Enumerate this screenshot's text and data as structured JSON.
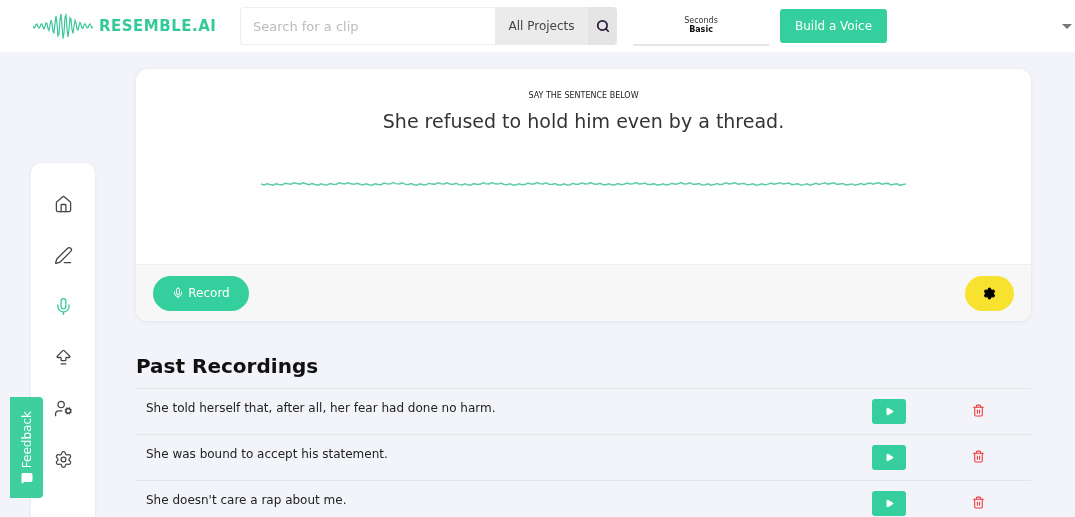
{
  "header": {
    "logo": "RESEMBLE.AI",
    "search": {
      "placeholder": "Search for a clip"
    },
    "project_filter": "All Projects",
    "plan": {
      "label": "Seconds",
      "value": "Basic"
    },
    "build_button": "Build a Voice"
  },
  "sidebar": {
    "items": [
      {
        "kind": "home",
        "selected": false
      },
      {
        "kind": "edit",
        "selected": false
      },
      {
        "kind": "record",
        "selected": true
      },
      {
        "kind": "upload",
        "selected": false
      },
      {
        "kind": "users",
        "selected": false
      },
      {
        "kind": "settings",
        "selected": false
      }
    ]
  },
  "feedback": "Feedback",
  "prompt": {
    "caption": "SAY THE SENTENCE BELOW",
    "sentence": "She refused to hold him even by a thread.",
    "record_button": "Record"
  },
  "past_recordings": {
    "title": "Past Recordings",
    "rows": [
      {
        "text": "She told herself that, after all, her fear had done no harm."
      },
      {
        "text": "She was bound to accept his statement."
      },
      {
        "text": "She doesn't care a rap about me."
      }
    ]
  }
}
